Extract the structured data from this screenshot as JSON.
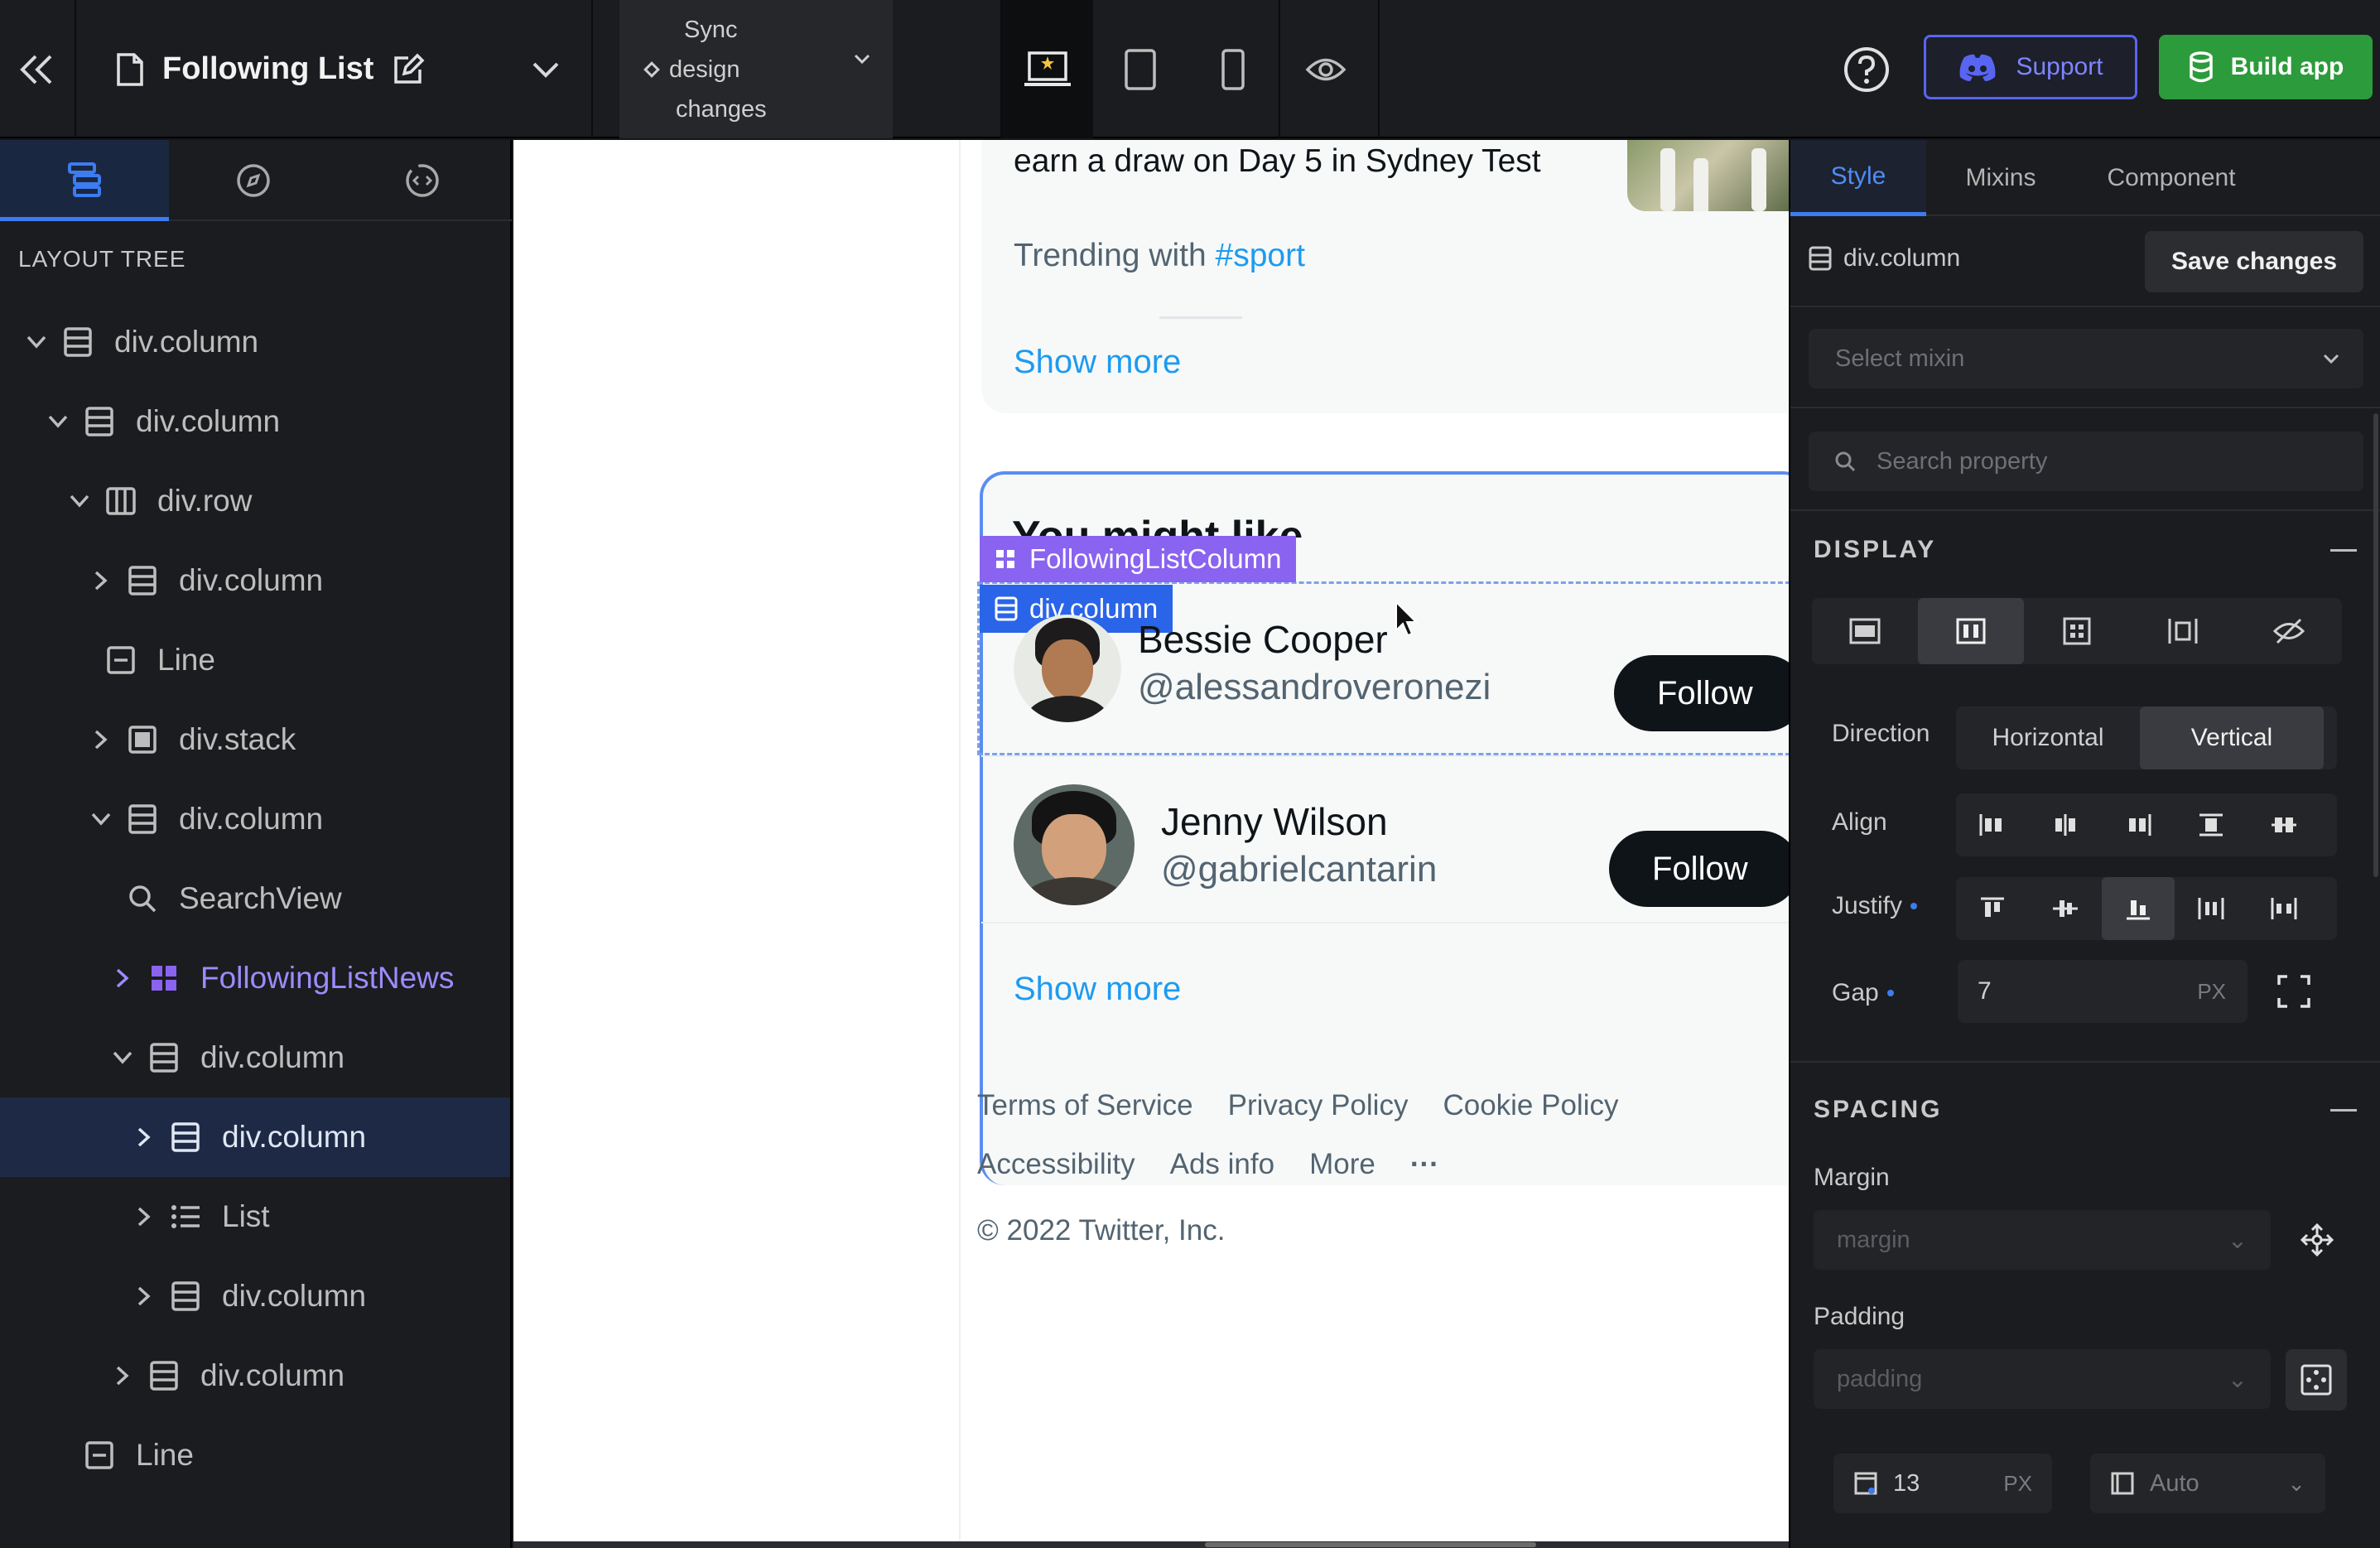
{
  "topbar": {
    "project_title": "Following List",
    "sync": [
      "Sync",
      "design",
      "changes"
    ],
    "support_label": "Support",
    "build_label": "Build app",
    "devices": [
      "laptop-icon",
      "tablet-icon",
      "mobile-icon",
      "eye-icon"
    ]
  },
  "left": {
    "heading": "LAYOUT TREE",
    "tree": [
      {
        "label": "div.column",
        "depth": 0,
        "chevron": "down",
        "icon": "column-icon"
      },
      {
        "label": "div.column",
        "depth": 1,
        "chevron": "down",
        "icon": "column-icon"
      },
      {
        "label": "div.row",
        "depth": 2,
        "chevron": "down",
        "icon": "row-icon"
      },
      {
        "label": "div.column",
        "depth": 3,
        "chevron": "right",
        "icon": "column-icon"
      },
      {
        "label": "Line",
        "depth": 2,
        "chevron": "none",
        "icon": "line-icon"
      },
      {
        "label": "div.stack",
        "depth": 3,
        "chevron": "right",
        "icon": "stack-icon"
      },
      {
        "label": "div.column",
        "depth": 3,
        "chevron": "down",
        "icon": "column-icon"
      },
      {
        "label": "SearchView",
        "depth": 3,
        "chevron": "none",
        "icon": "search-icon"
      },
      {
        "label": "FollowingListNews",
        "depth": 4,
        "chevron": "right",
        "icon": "component-icon",
        "component": true
      },
      {
        "label": "div.column",
        "depth": 4,
        "chevron": "down",
        "icon": "column-icon"
      },
      {
        "label": "div.column",
        "depth": 5,
        "chevron": "right",
        "icon": "column-icon",
        "selected": true
      },
      {
        "label": "List",
        "depth": 5,
        "chevron": "right",
        "icon": "list-icon"
      },
      {
        "label": "div.column",
        "depth": 5,
        "chevron": "right",
        "icon": "column-icon"
      },
      {
        "label": "div.column",
        "depth": 4,
        "chevron": "right",
        "icon": "column-icon"
      },
      {
        "label": "Line",
        "depth": 1,
        "chevron": "none",
        "icon": "line-icon"
      }
    ]
  },
  "canvas": {
    "news_text": "earn a draw on Day 5 in Sydney Test",
    "trending_prefix": "Trending with ",
    "trending_tag": "#sport",
    "show_more_1": "Show more",
    "you_might_like": "You might like",
    "badge_component": "FollowingListColumn",
    "badge_element": "div.column",
    "users": [
      {
        "name": "Bessie Cooper",
        "handle": "@alessandroveronezi",
        "follow": "Follow"
      },
      {
        "name": "Jenny Wilson",
        "handle": "@gabrielcantarin",
        "follow": "Follow"
      }
    ],
    "show_more_2": "Show more",
    "footer_links_1": [
      "Terms of Service",
      "Privacy Policy",
      "Cookie Policy"
    ],
    "footer_links_2": [
      "Accessibility",
      "Ads info",
      "More",
      "···"
    ],
    "copyright": "© 2022 Twitter, Inc."
  },
  "right": {
    "tabs": [
      "Style",
      "Mixins",
      "Component"
    ],
    "element": "div.column",
    "save_label": "Save changes",
    "mixin_placeholder": "Select mixin",
    "search_placeholder": "Search property",
    "display_title": "DISPLAY",
    "direction_label": "Direction",
    "direction_options": [
      "Horizontal",
      "Vertical"
    ],
    "direction_value": "Vertical",
    "align_label": "Align",
    "justify_label": "Justify",
    "gap_label": "Gap",
    "gap_value": "7",
    "gap_unit": "PX",
    "spacing_title": "SPACING",
    "margin_label": "Margin",
    "margin_placeholder": "margin",
    "padding_label": "Padding",
    "padding_placeholder": "padding",
    "pad_top_value": "13",
    "pad_top_unit": "PX",
    "pad_side_value": "Auto"
  },
  "colors": {
    "accent": "#3d7cf0",
    "component": "#8a63f0",
    "discord": "#5865f2",
    "build": "#2c9b3b",
    "twitter_blue": "#1d9bf0"
  }
}
